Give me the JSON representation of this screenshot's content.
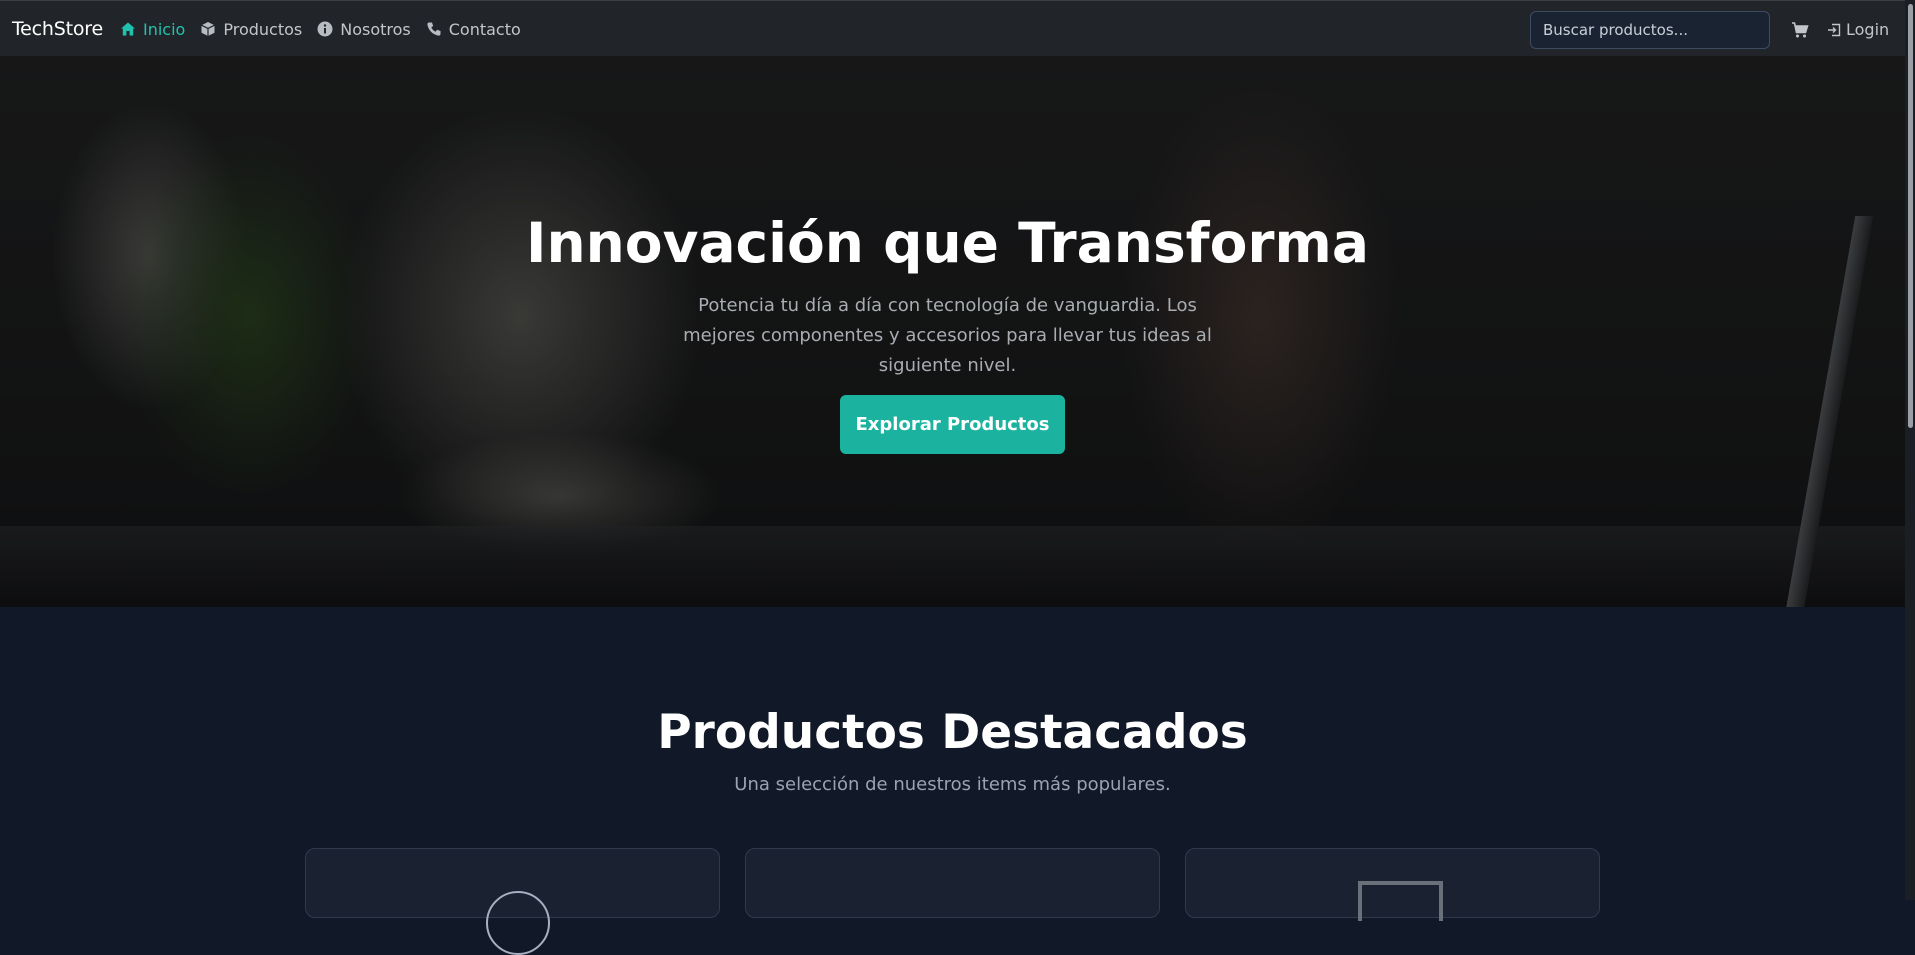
{
  "brand": "TechStore",
  "nav": {
    "items": [
      {
        "label": "Inicio",
        "icon": "home-icon",
        "active": true
      },
      {
        "label": "Productos",
        "icon": "box-icon",
        "active": false
      },
      {
        "label": "Nosotros",
        "icon": "info-icon",
        "active": false
      },
      {
        "label": "Contacto",
        "icon": "phone-icon",
        "active": false
      }
    ]
  },
  "search": {
    "placeholder": "Buscar productos..."
  },
  "cart": {
    "icon": "cart-icon"
  },
  "login": {
    "label": "Login",
    "icon": "login-icon"
  },
  "hero": {
    "title": "Innovación que Transforma",
    "subtitle": "Potencia tu día a día con tecnología de vanguardia. Los mejores componentes y accesorios para llevar tus ideas al siguiente nivel.",
    "cta": "Explorar Productos"
  },
  "featured": {
    "title": "Productos Destacados",
    "subtitle": "Una selección de nuestros items más populares."
  },
  "colors": {
    "accent": "#20c2ad",
    "button": "#1bb3a0",
    "navbar": "#212529",
    "section_bg": "#111827",
    "card_bg": "#1a2232"
  }
}
